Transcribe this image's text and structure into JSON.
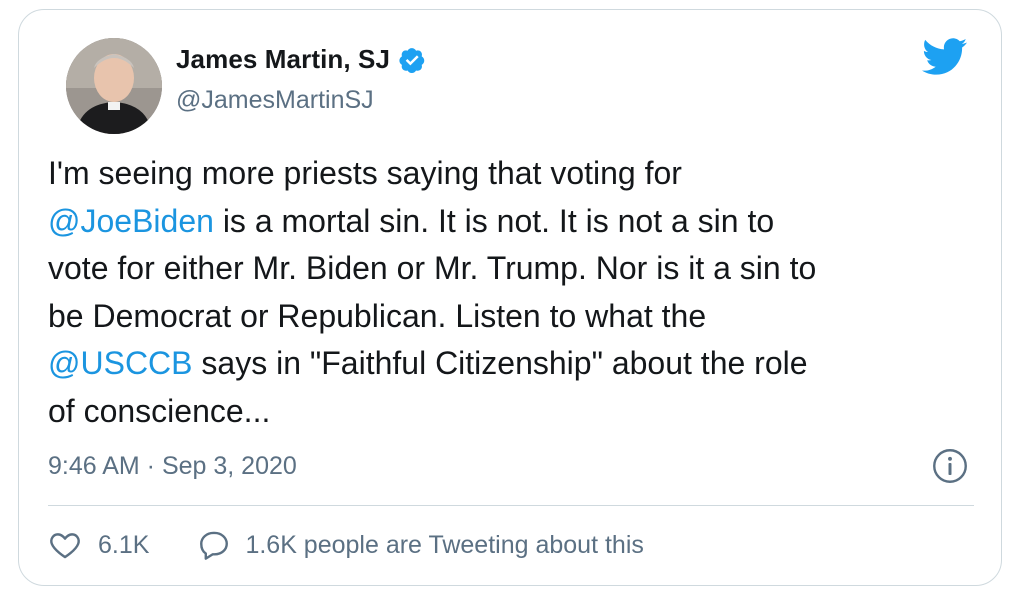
{
  "author": {
    "name": "James Martin, SJ",
    "handle": "@JamesMartinSJ",
    "verified_icon": "verified-badge-icon",
    "avatar": "profile-photo"
  },
  "brand": {
    "icon": "twitter-bird-icon",
    "color": "#1da1f2"
  },
  "tweet": {
    "line1": "I'm seeing more priests saying that voting for",
    "mention1": "@JoeBiden",
    "line2_rest": " is a mortal sin. It is not. It is not a sin to",
    "line3": "vote for either Mr. Biden or Mr. Trump. Nor is it a sin to",
    "line4": "be Democrat or Republican. Listen to what the",
    "mention2": "@USCCB",
    "line5_rest": " says in \"Faithful Citizenship\" about the role",
    "line6": "of conscience..."
  },
  "meta": {
    "timestamp": "9:46 AM · Sep 3, 2020",
    "info_icon": "info-icon"
  },
  "actions": {
    "like_icon": "heart-icon",
    "like_count": "6.1K",
    "reply_icon": "comment-bubble-icon",
    "reply_text": "1.6K people are Tweeting about this"
  },
  "colors": {
    "link": "#1b95e0",
    "secondary_text": "#5b7083",
    "border": "#cfd9de"
  }
}
